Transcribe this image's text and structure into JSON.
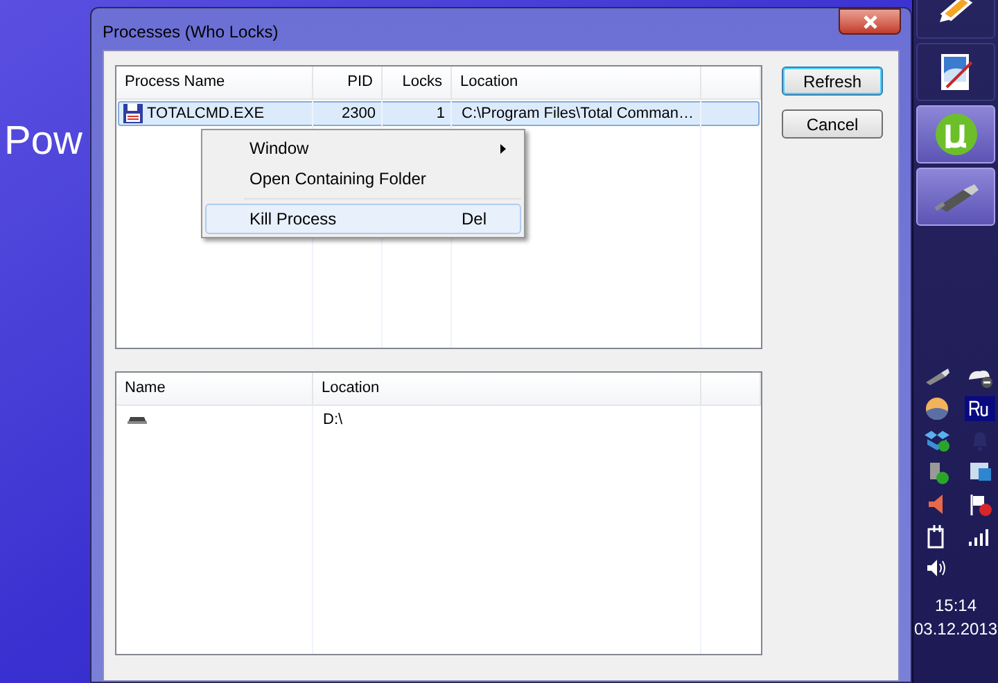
{
  "desktop": {
    "text": "Pow"
  },
  "window": {
    "title": "Processes (Who Locks)"
  },
  "processes": {
    "columns": [
      "Process Name",
      "PID",
      "Locks",
      "Location"
    ],
    "rows": [
      {
        "name": "TOTALCMD.EXE",
        "pid": "2300",
        "locks": "1",
        "location": "C:\\Program Files\\Total Comman…",
        "selected": true
      }
    ]
  },
  "context_menu": [
    {
      "kind": "submenu",
      "label": "Window",
      "selected": false
    },
    {
      "kind": "command",
      "label": "Open Containing Folder",
      "selected": false
    },
    {
      "kind": "separator"
    },
    {
      "kind": "command",
      "label": "Kill Process",
      "shortcut": "Del",
      "selected": true
    }
  ],
  "buttons": [
    {
      "label": "Refresh",
      "default": true
    },
    {
      "label": "Cancel",
      "default": false
    }
  ],
  "files": {
    "columns": [
      "Name",
      "Location"
    ],
    "rows": [
      {
        "location": "D:\\",
        "selected": false
      }
    ]
  },
  "taskbar_buttons": [
    {
      "active": false
    },
    {
      "active": false
    },
    {
      "active": true
    },
    {
      "active": true
    }
  ],
  "clock": {
    "time": "15:14",
    "date": "03.12.2013"
  }
}
